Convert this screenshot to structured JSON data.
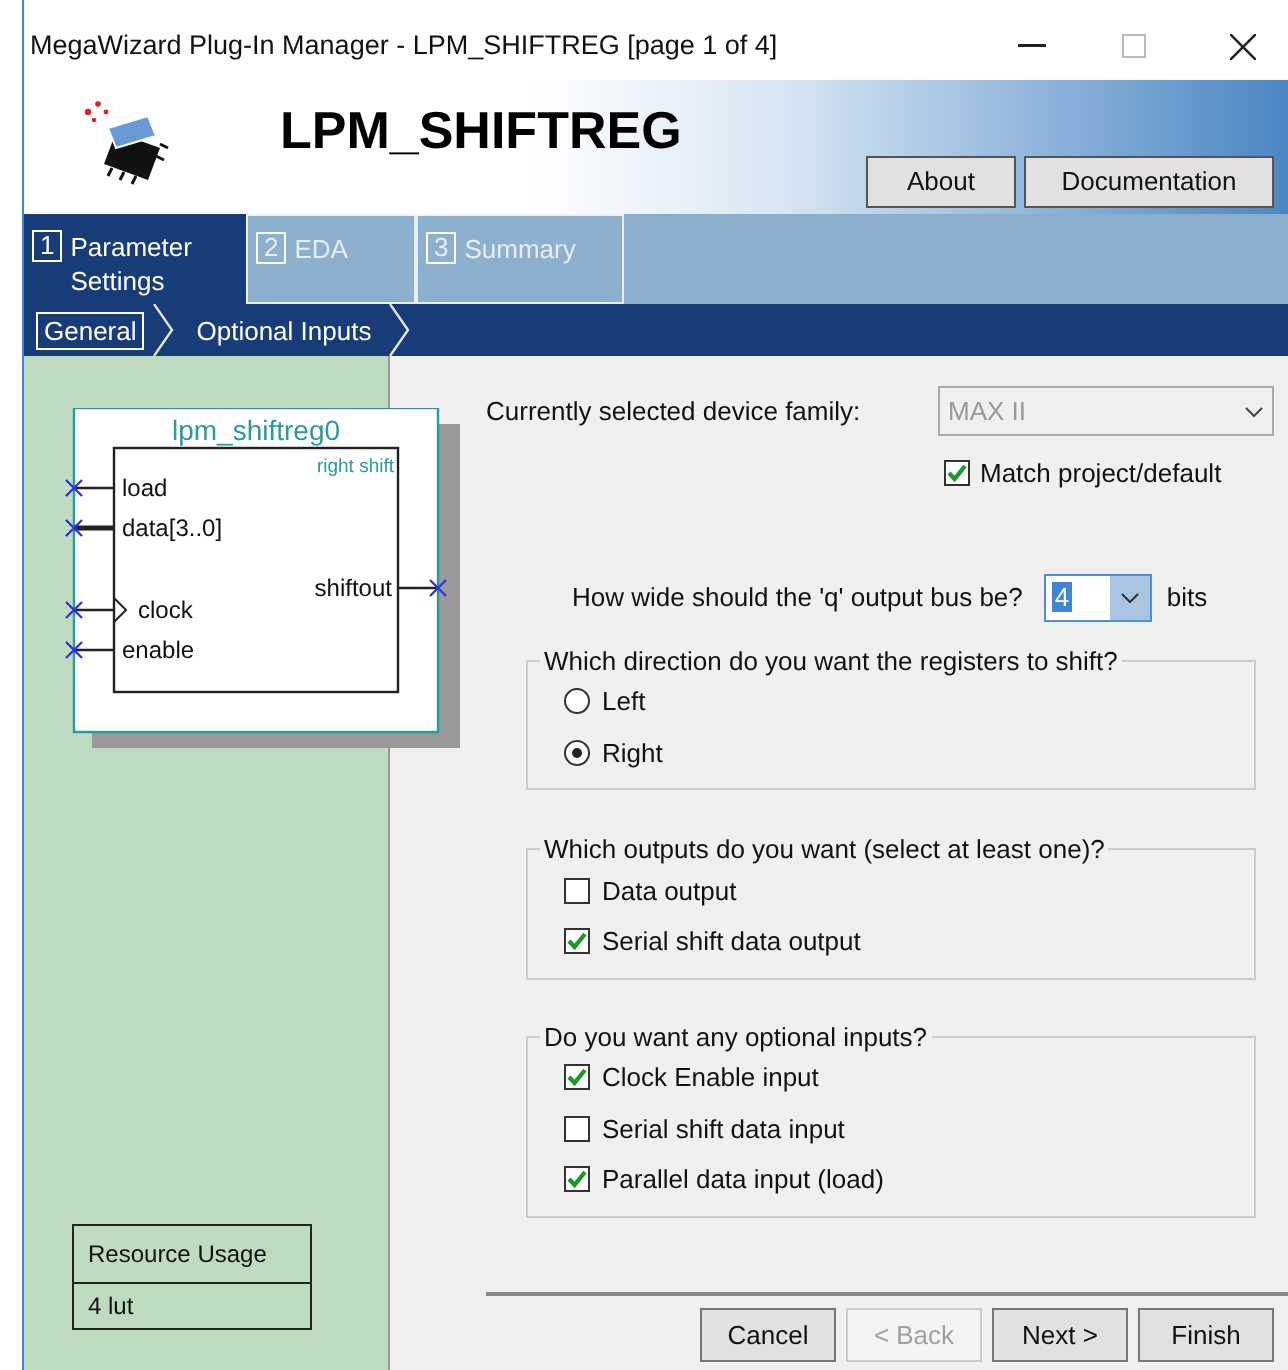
{
  "window": {
    "title": "MegaWizard Plug-In Manager - LPM_SHIFTREG [page 1 of 4]"
  },
  "header": {
    "title": "LPM_SHIFTREG",
    "buttons": [
      "About",
      "Documentation"
    ]
  },
  "tabs": [
    {
      "number": "1",
      "label": "Parameter Settings",
      "selected": true
    },
    {
      "number": "2",
      "label": "EDA",
      "selected": false
    },
    {
      "number": "3",
      "label": "Summary",
      "selected": false
    }
  ],
  "breadcrumb": [
    {
      "label": "General",
      "selected": true
    },
    {
      "label": "Optional Inputs",
      "selected": false
    }
  ],
  "symbol": {
    "title": "lpm_shiftreg0",
    "mode": "right shift",
    "inputs": [
      {
        "label": "load",
        "kind": "plain"
      },
      {
        "label": "data[3..0]",
        "kind": "bus"
      },
      {
        "label": "clock",
        "kind": "clock"
      },
      {
        "label": "enable",
        "kind": "plain"
      }
    ],
    "outputs": [
      "shiftout"
    ]
  },
  "resource": {
    "heading": "Resource Usage",
    "value": "4 lut"
  },
  "device": {
    "label": "Currently selected device family:",
    "value": "MAX II",
    "disabled": true,
    "match": {
      "label": "Match project/default",
      "checked": true
    }
  },
  "width": {
    "label": "How wide should the 'q' output bus be?",
    "value": "4",
    "unit": "bits"
  },
  "groups": [
    {
      "title": "Which direction do you want the registers to shift?",
      "kind": "radio",
      "options": [
        {
          "label": "Left",
          "selected": false
        },
        {
          "label": "Right",
          "selected": true
        }
      ]
    },
    {
      "title": "Which outputs do you want (select at least one)?",
      "kind": "checkbox",
      "options": [
        {
          "label": "Data output",
          "checked": false
        },
        {
          "label": "Serial shift data output",
          "checked": true
        }
      ]
    },
    {
      "title": "Do you want any optional inputs?",
      "kind": "checkbox",
      "options": [
        {
          "label": "Clock Enable input",
          "checked": true
        },
        {
          "label": "Serial shift data input",
          "checked": false
        },
        {
          "label": "Parallel data input (load)",
          "checked": true
        }
      ]
    }
  ],
  "buttons": [
    {
      "label": "Cancel",
      "disabled": false
    },
    {
      "label": "< Back",
      "disabled": true
    },
    {
      "label": "Next >",
      "disabled": false
    },
    {
      "label": "Finish",
      "disabled": false
    }
  ]
}
